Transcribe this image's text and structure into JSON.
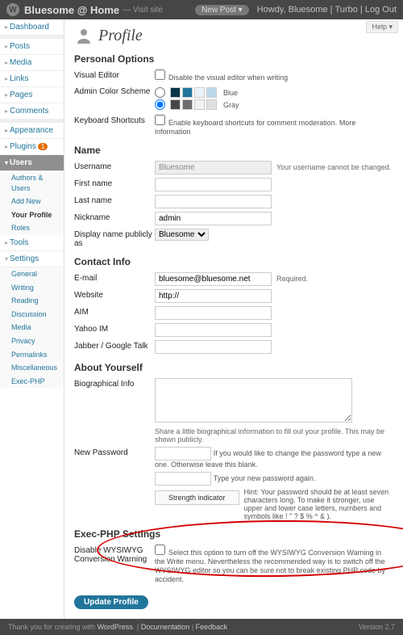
{
  "topbar": {
    "site": "Bluesome @ Home",
    "visit": "— Visit site",
    "newpost": "New Post ▾",
    "howdy": "Howdy,",
    "user": "Bluesome",
    "turbo": "Turbo",
    "logout": "Log Out",
    "help": "Help ▾"
  },
  "menu": {
    "dashboard": "Dashboard",
    "posts": "Posts",
    "media": "Media",
    "links": "Links",
    "pages": "Pages",
    "comments": "Comments",
    "appearance": "Appearance",
    "plugins": "Plugins",
    "plugins_badge": "1",
    "users": "Users",
    "users_sub": [
      "Authors & Users",
      "Add New",
      "Your Profile",
      "Roles"
    ],
    "tools": "Tools",
    "settings": "Settings",
    "settings_sub": [
      "General",
      "Writing",
      "Reading",
      "Discussion",
      "Media",
      "Privacy",
      "Permalinks",
      "Miscellaneous",
      "Exec-PHP"
    ]
  },
  "page": {
    "title": "Profile"
  },
  "sections": {
    "personal": "Personal Options",
    "name": "Name",
    "contact": "Contact Info",
    "about": "About Yourself",
    "exec": "Exec-PHP Settings"
  },
  "labels": {
    "visual_editor": "Visual Editor",
    "visual_editor_cb": "Disable the visual editor when writing",
    "admin_color": "Admin Color Scheme",
    "blue": "Blue",
    "gray": "Gray",
    "kb_shortcuts": "Keyboard Shortcuts",
    "kb_cb": "Enable keyboard shortcuts for comment moderation.",
    "more_info": "More information",
    "username": "Username",
    "username_note": "Your username cannot be changed.",
    "first_name": "First name",
    "last_name": "Last name",
    "nickname": "Nickname",
    "display_as": "Display name publicly as",
    "email": "E-mail",
    "email_note": "Required.",
    "website": "Website",
    "aim": "AIM",
    "yahoo": "Yahoo IM",
    "jabber": "Jabber / Google Talk",
    "bio": "Biographical Info",
    "bio_note": "Share a little biographical information to fill out your profile. This may be shown publicly.",
    "newpw": "New Password",
    "newpw_note": "If you would like to change the password type a new one. Otherwise leave this blank.",
    "newpw_note2": "Type your new password again.",
    "strength": "Strength indicator",
    "strength_hint": "Hint: Your password should be at least seven characters long. To make it stronger, use upper and lower case letters, numbers and symbols like ! \" ? $ % ^ & ).",
    "disable_wys": "Disable WYSIWYG Conversion Warning",
    "disable_wys_note": "Select this option to turn off the WYSIWYG Conversion Warning in the Write menu. Nevertheless the recommended way is to switch off the WYSIWYG editor so you can be sure not to break existing PHP code by accident.",
    "update": "Update Profile"
  },
  "values": {
    "username": "Bluesome",
    "nickname": "admin",
    "display_as": "Bluesome",
    "email": "bluesome@bluesome.net",
    "website": "http://"
  },
  "colors": {
    "blue": [
      "#073447",
      "#21759b",
      "#eaf3fa",
      "#bbd8e7"
    ],
    "gray": [
      "#464646",
      "#6d6d6d",
      "#f1f1f1",
      "#dfdfdf"
    ]
  },
  "footer": {
    "thanks": "Thank you for creating with ",
    "wp": "WordPress",
    "docs": "Documentation",
    "feedback": "Feedback",
    "version": "Version 2.7"
  }
}
